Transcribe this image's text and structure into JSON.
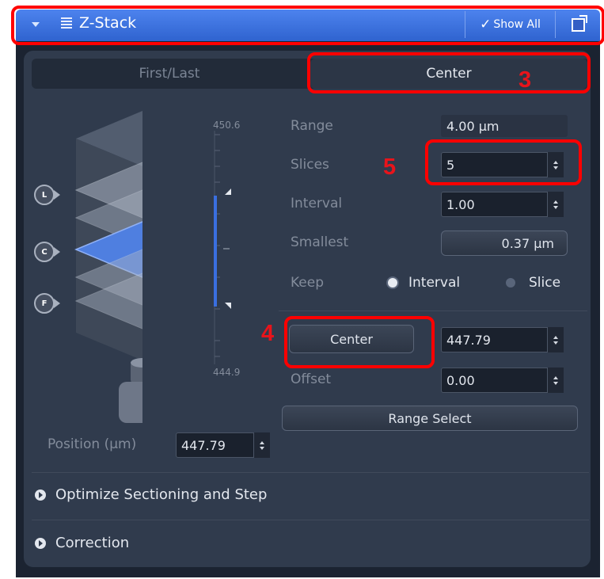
{
  "header": {
    "title": "Z-Stack",
    "show_all_label": "Show All",
    "icons": [
      "collapse-arrow-icon",
      "list-icon",
      "checkmark-icon",
      "popout-icon"
    ]
  },
  "tabs": {
    "first_last": "First/Last",
    "center": "Center",
    "active": "Center"
  },
  "cube": {
    "buttons": {
      "last": "L",
      "center": "C",
      "first": "F"
    },
    "scale_top": "450.6",
    "scale_bottom": "444.9"
  },
  "position": {
    "label": "Position (µm)",
    "value": "447.79"
  },
  "form": {
    "range_label": "Range",
    "range_value": "4.00 µm",
    "slices_label": "Slices",
    "slices_value": "5",
    "interval_label": "Interval",
    "interval_value": "1.00",
    "smallest_label": "Smallest",
    "smallest_button": "0.37 µm",
    "keep_label": "Keep",
    "keep_options": [
      "Interval",
      "Slice"
    ],
    "keep_selected": "Interval",
    "center_button": "Center",
    "center_value": "447.79",
    "offset_label": "Offset",
    "offset_value": "0.00",
    "range_select_button": "Range Select"
  },
  "sections": {
    "optimize": "Optimize Sectioning and Step",
    "correction": "Correction"
  },
  "annotations": {
    "n3": "3",
    "n4": "4",
    "n5": "5"
  },
  "colors": {
    "header_blue": "#3a6fdd",
    "panel_bg": "#303b4d",
    "highlight_slice": "#4f7fe0",
    "range_bar": "#3a6fe0",
    "annotation_red": "#ff0000"
  }
}
